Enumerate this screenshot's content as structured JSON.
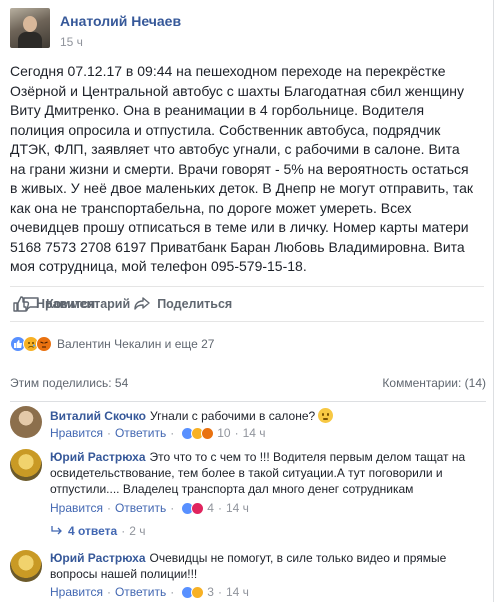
{
  "post": {
    "author": "Анатолий Нечаев",
    "time": "15 ч",
    "text": "Сегодня 07.12.17 в 09:44 на пешеходном переходе на перекрёстке\nОзёрной и Центральной автобус с шахты Благодатная сбил женщину\nВиту Дмитренко. Она в реанимации в 4 горбольнице. Водителя\nполиция опросила и отпустила. Собственник автобуса, подрядчик\nДТЭК, ФЛП, заявляет что автобус угнали, с рабочими в салоне. Вита\nна грани жизни и смерти. Врачи говорят - 5% на вероятность остаться\nв живых. У неё двое маленьких деток. В Днепр не могут отправить, так\nкак она не транспортабельна, по дороге может умереть. Всех\nочевидцев прошу отписаться в теме или в личку. Номер карты матери\n5168 7573 2708 6197 Приватбанк Баран Любовь Владимировна. Вита\nмоя сотрудница, мой телефон 095-579-15-18."
  },
  "actions": {
    "like": "Нравится",
    "comment": "Комментарий",
    "share": "Поделиться"
  },
  "reactions": {
    "summary": "Валентин Чекалин и еще 27",
    "icons": [
      "like-reaction-icon",
      "sad-reaction-icon",
      "angry-reaction-icon"
    ]
  },
  "stats": {
    "shares": "Этим поделились: 54",
    "comments": "Комментарии: (14)"
  },
  "comments": [
    {
      "author": "Виталий Скочко",
      "text": "Угнали с рабочими в салоне?",
      "like": "Нравится",
      "reply": "Ответить",
      "reaction_count": "10",
      "time": "14 ч"
    },
    {
      "author": "Юрий Растрюха",
      "text": "Это что то с чем то !!! Водителя первым делом тащат на освидетельствование, тем более в такой ситуации.А тут поговорили и отпустили.... Владелец транспорта дал много денег сотрудникам",
      "like": "Нравится",
      "reply": "Ответить",
      "reaction_count": "4",
      "time": "14 ч",
      "replies_label": "4 ответа",
      "replies_time": "2 ч"
    },
    {
      "author": "Юрий Растрюха",
      "text": "Очевидцы не помогут, в силе только видео и прямые вопросы нашей полиции!!!",
      "like": "Нравится",
      "reply": "Ответить",
      "reaction_count": "3",
      "time": "14 ч"
    }
  ],
  "colors": {
    "link": "#365899",
    "meta": "#90949c",
    "like_blue": "#5890ff",
    "sad_yellow": "#f7b125",
    "angry_orange": "#e9710f"
  }
}
